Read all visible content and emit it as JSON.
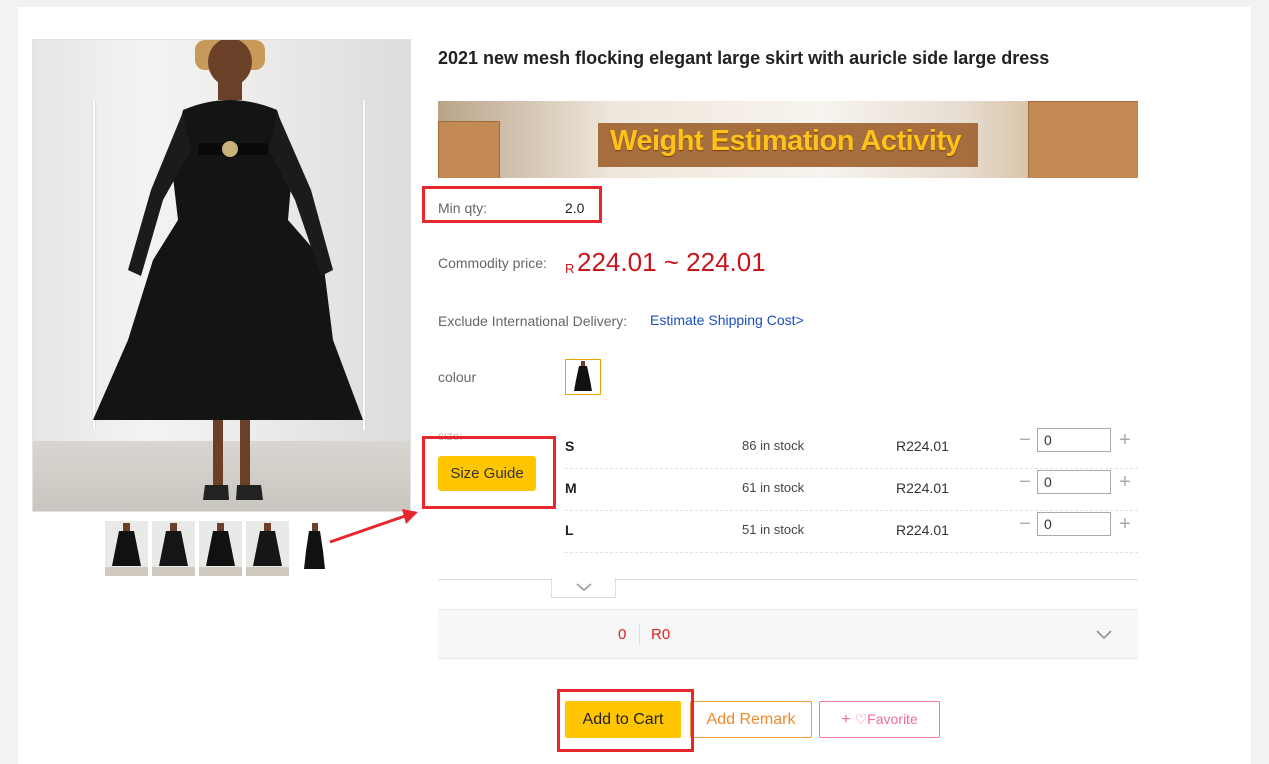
{
  "product": {
    "title": "2021 new mesh flocking elegant large skirt with auricle side large dress",
    "banner_text": "Weight Estimation Activity"
  },
  "min_qty": {
    "label": "Min qty:",
    "value": "2.0"
  },
  "price": {
    "label": "Commodity price:",
    "currency": "R",
    "range": "224.01 ~ 224.01"
  },
  "delivery": {
    "label": "Exclude International Delivery:",
    "link": "Estimate Shipping Cost>"
  },
  "colour": {
    "label": "colour",
    "selected": "black"
  },
  "size": {
    "label": "size:",
    "guide_button": "Size Guide",
    "rows": [
      {
        "size": "S",
        "stock": "86 in stock",
        "price": "R224.01",
        "qty": "0"
      },
      {
        "size": "M",
        "stock": "61 in stock",
        "price": "R224.01",
        "qty": "0"
      },
      {
        "size": "L",
        "stock": "51 in stock",
        "price": "R224.01",
        "qty": "0"
      }
    ]
  },
  "summary": {
    "qty": "0",
    "amount": "R0"
  },
  "actions": {
    "add_to_cart": "Add to Cart",
    "add_remark": "Add Remark",
    "favorite": "♡Favorite",
    "favorite_plus": "+"
  },
  "icons": {
    "decrement": "−",
    "increment": "+",
    "expand": "chevron-down-icon",
    "favorite": "heart-icon"
  },
  "colors": {
    "accent": "#ffc600",
    "price": "#c8161d",
    "link": "#1b4fbf",
    "highlight": "#e8262d",
    "remark": "#f08a2a",
    "favorite": "#f06aa0"
  }
}
